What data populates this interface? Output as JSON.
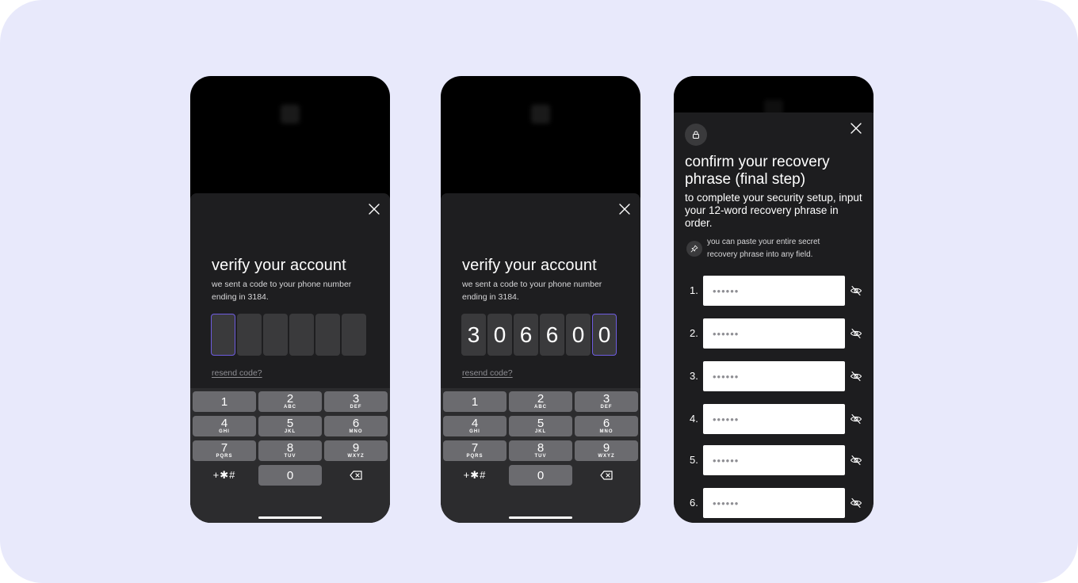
{
  "screens": [
    {
      "title": "verify your account",
      "subtitle": "we sent a code to your phone number ending in 3184.",
      "code_digits": [
        "",
        "",
        "",
        "",
        "",
        ""
      ],
      "active_index": 0,
      "resend_label": "resend code?"
    },
    {
      "title": "verify your account",
      "subtitle": "we sent a code to your phone number ending in 3184.",
      "code_digits": [
        "3",
        "0",
        "6",
        "6",
        "0",
        "0"
      ],
      "active_index": 5,
      "resend_label": "resend code?"
    }
  ],
  "keypad": {
    "keys": [
      {
        "num": "1",
        "letters": ""
      },
      {
        "num": "2",
        "letters": "ABC"
      },
      {
        "num": "3",
        "letters": "DEF"
      },
      {
        "num": "4",
        "letters": "GHI"
      },
      {
        "num": "5",
        "letters": "JKL"
      },
      {
        "num": "6",
        "letters": "MNO"
      },
      {
        "num": "7",
        "letters": "PQRS"
      },
      {
        "num": "8",
        "letters": "TUV"
      },
      {
        "num": "9",
        "letters": "WXYZ"
      }
    ],
    "symbols_label": "+✱#",
    "zero": "0"
  },
  "recovery": {
    "title": "confirm your recovery phrase (final step)",
    "description": "to complete your security setup, input your 12-word recovery phrase in order.",
    "tip": "you can paste your entire secret recovery phrase into any field.",
    "fields": [
      {
        "num": "1.",
        "placeholder": "••••••"
      },
      {
        "num": "2.",
        "placeholder": "••••••"
      },
      {
        "num": "3.",
        "placeholder": "••••••"
      },
      {
        "num": "4.",
        "placeholder": "••••••"
      },
      {
        "num": "5.",
        "placeholder": "••••••"
      },
      {
        "num": "6.",
        "placeholder": "••••••"
      }
    ]
  },
  "colors": {
    "background": "#e8e9fb",
    "sheet": "#1e1e20",
    "accent": "#6e5ce0",
    "key": "#6b6b6f"
  }
}
